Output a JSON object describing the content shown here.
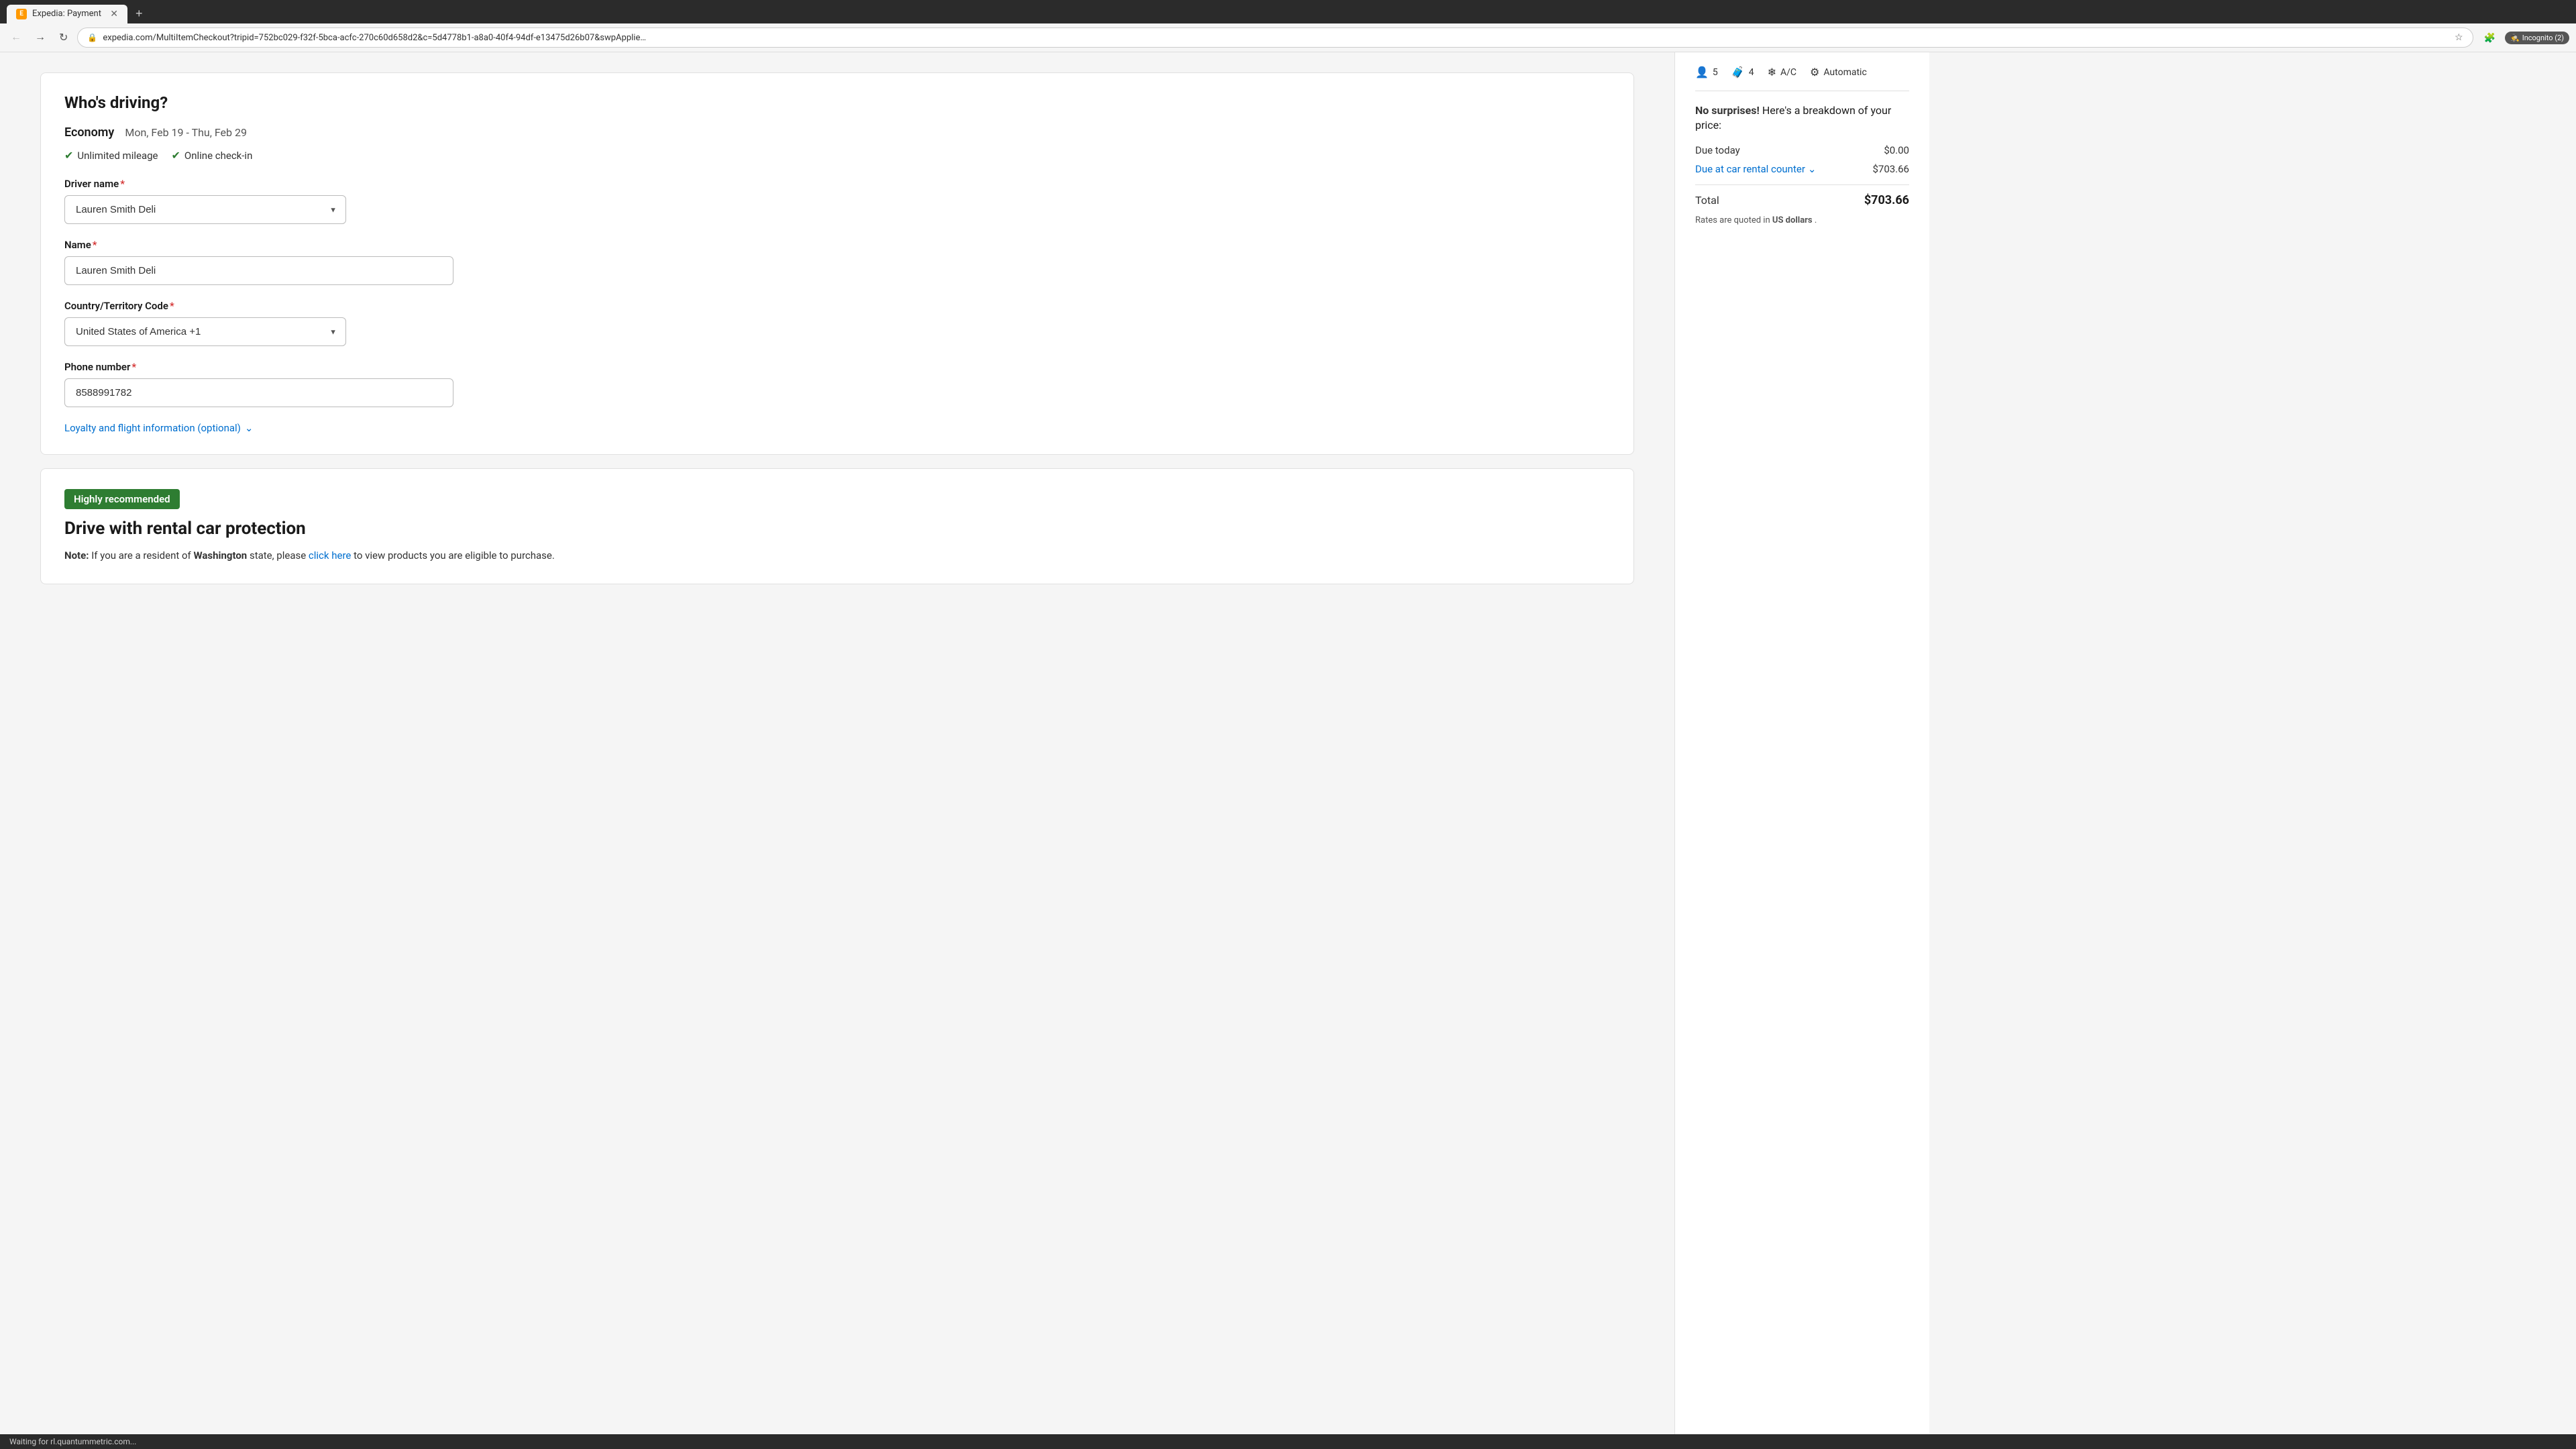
{
  "browser": {
    "tab_title": "Expedia: Payment",
    "tab_favicon": "E",
    "url": "expedia.com/MultiItemCheckout?tripid=752bc029-f32f-5bca-acfc-270c60d658d2&c=5d4778b1-a8a0-40f4-94df-e13475d26b07&swpApplie…",
    "incognito_label": "Incognito (2)"
  },
  "page": {
    "section_title": "Who's driving?",
    "car_type": "Economy",
    "car_dates": "Mon, Feb 19 - Thu, Feb 29",
    "feature_unlimited_mileage": "Unlimited mileage",
    "feature_online_checkin": "Online check-in",
    "driver_name_label": "Driver name",
    "driver_name_value": "Lauren Smith Deli",
    "name_label": "Name",
    "name_value": "Lauren Smith Deli",
    "country_code_label": "Country/Territory Code",
    "country_code_value": "United States of America +1",
    "phone_label": "Phone number",
    "phone_value": "8588991782",
    "loyalty_link_text": "Loyalty and flight information (optional)",
    "recommended_badge": "Highly recommended",
    "protection_title": "Drive with rental car protection",
    "protection_note_prefix": "Note:",
    "protection_note_text": " If you are a resident of ",
    "protection_state": "Washington",
    "protection_note_middle": " state, please ",
    "protection_link_text": "click here",
    "protection_note_suffix": " to view products you are eligible to purchase."
  },
  "sidebar": {
    "passengers": "5",
    "bags": "4",
    "ac_label": "A/C",
    "transmission": "Automatic",
    "no_surprises_label": "No surprises!",
    "breakdown_label": " Here's a breakdown of your price:",
    "due_today_label": "Due today",
    "due_today_value": "$0.00",
    "due_at_counter_label": "Due at car rental counter",
    "due_at_counter_value": "$703.66",
    "total_label": "Total",
    "total_value": "$703.66",
    "rates_note_prefix": "Rates are quoted in ",
    "rates_note_currency": "US dollars",
    "rates_note_suffix": "."
  },
  "status_bar": {
    "text": "Waiting for rl.quantummetric.com..."
  }
}
